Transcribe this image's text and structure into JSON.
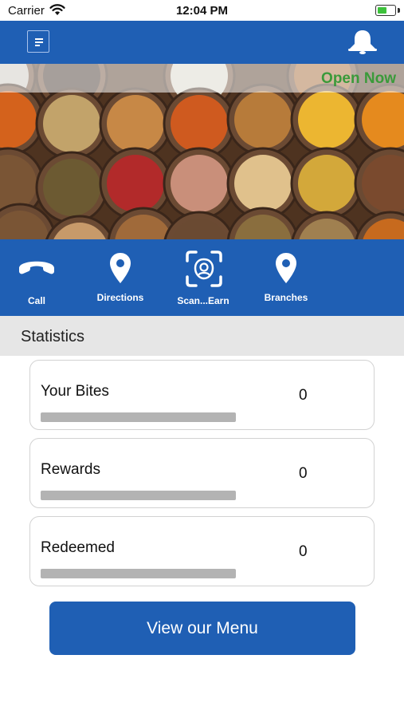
{
  "status_bar": {
    "carrier": "Carrier",
    "time": "12:04 PM",
    "battery_level": 0.55,
    "battery_color": "#3cc13b"
  },
  "header": {
    "menu_icon": "menu-list-icon",
    "notification_icon": "bell-icon",
    "color": "#1f5fb4"
  },
  "hero": {
    "status": "Open Now",
    "status_color": "#3a9a3a",
    "image": "spices-bowls-photo"
  },
  "actions": [
    {
      "label": "Call",
      "icon": "phone-icon"
    },
    {
      "label": "Directions",
      "icon": "location-pin-icon"
    },
    {
      "label": "Scan...Earn",
      "icon": "scan-icon"
    },
    {
      "label": "Branches",
      "icon": "location-pin-icon"
    }
  ],
  "statistics": {
    "title": "Statistics",
    "items": [
      {
        "label": "Your Bites",
        "value": "0",
        "progress": 0
      },
      {
        "label": "Rewards",
        "value": "0",
        "progress": 0
      },
      {
        "label": "Redeemed",
        "value": "0",
        "progress": 0
      }
    ]
  },
  "menu_button": {
    "label": "View our Menu"
  }
}
